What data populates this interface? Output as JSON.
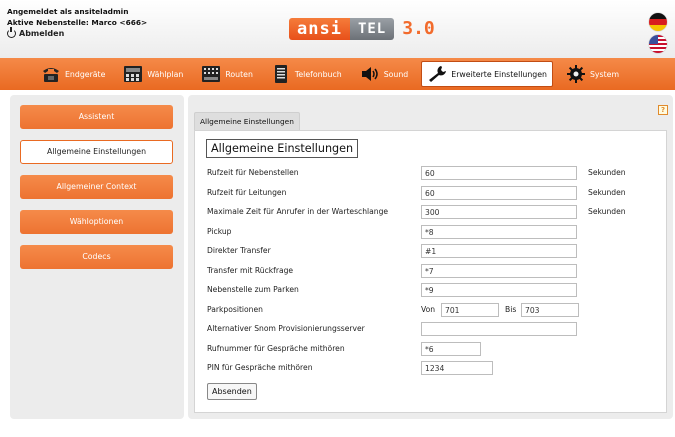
{
  "header": {
    "logged_in_as": "Angemeldet als ansiteladmin",
    "active_extension": "Aktive Nebenstelle: Marco <666>",
    "logout_label": "Abmelden",
    "logo_part1": "ansi",
    "logo_part2": "TEL",
    "logo_version": "3.0",
    "flags": [
      "german-flag-icon",
      "us-flag-icon"
    ]
  },
  "nav": {
    "items": [
      {
        "label": "Endgeräte",
        "icon": "phone-icon"
      },
      {
        "label": "Wählplan",
        "icon": "dialplan-icon"
      },
      {
        "label": "Routen",
        "icon": "switchboard-icon"
      },
      {
        "label": "Telefonbuch",
        "icon": "phonebook-icon"
      },
      {
        "label": "Sound",
        "icon": "speaker-icon"
      },
      {
        "label": "Erweiterte Einstellungen",
        "icon": "wrench-icon",
        "active": true
      },
      {
        "label": "System",
        "icon": "gear-icon"
      }
    ]
  },
  "sidebar": {
    "items": [
      {
        "label": "Assistent"
      },
      {
        "label": "Allgemeine Einstellungen",
        "active": true
      },
      {
        "label": "Allgemeiner Context"
      },
      {
        "label": "Wähloptionen"
      },
      {
        "label": "Codecs"
      }
    ]
  },
  "main": {
    "help": "?",
    "tab_label": "Allgemeine Einstellungen",
    "title": "Allgemeine Einstellungen",
    "fields": [
      {
        "label": "Rufzeit für Nebenstellen",
        "value": "60",
        "unit": "Sekunden"
      },
      {
        "label": "Rufzeit für Leitungen",
        "value": "60",
        "unit": "Sekunden"
      },
      {
        "label": "Maximale Zeit für Anrufer in der Warteschlange",
        "value": "300",
        "unit": "Sekunden"
      },
      {
        "label": "Pickup",
        "value": "*8"
      },
      {
        "label": "Direkter Transfer",
        "value": "#1"
      },
      {
        "label": "Transfer mit Rückfrage",
        "value": "*7"
      },
      {
        "label": "Nebenstelle zum Parken",
        "value": "*9"
      }
    ],
    "parking": {
      "label": "Parkpositionen",
      "from_label": "Von",
      "from_value": "701",
      "to_label": "Bis",
      "to_value": "703"
    },
    "snom": {
      "label": "Alternativer Snom Provisionierungsserver",
      "value": ""
    },
    "monitor_number": {
      "label": "Rufnummer für Gespräche mithören",
      "value": "*6"
    },
    "monitor_pin": {
      "label": "PIN für Gespräche mithören",
      "value": "1234"
    },
    "submit_label": "Absenden"
  },
  "colors": {
    "accent": "#ee7533",
    "nav_bar": "#e96a22",
    "panel_bg": "#ececec"
  }
}
